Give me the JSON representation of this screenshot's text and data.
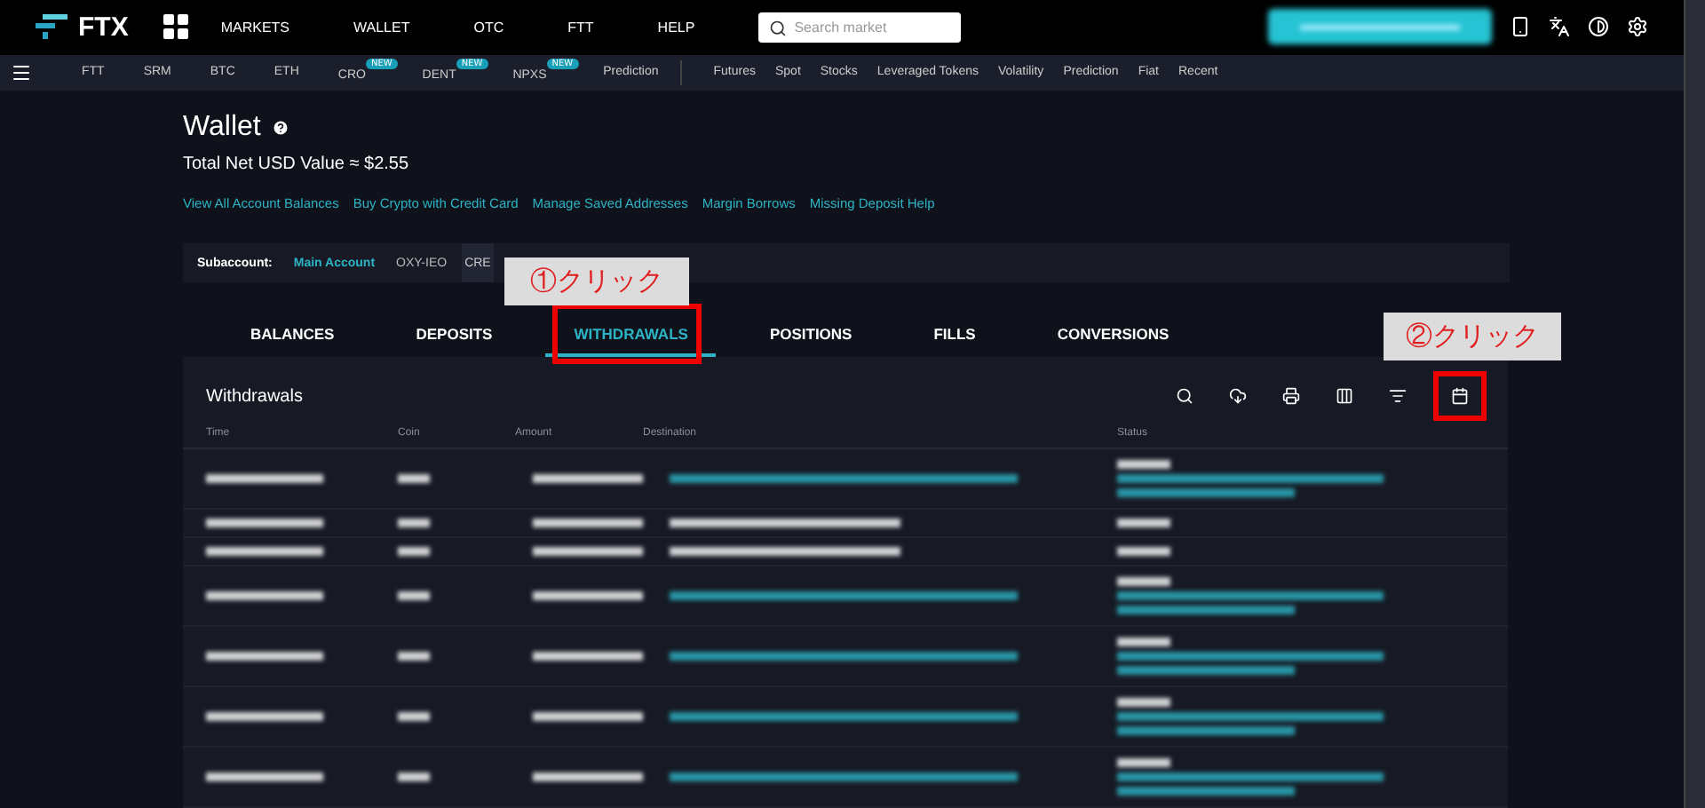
{
  "header": {
    "logo": "FTX",
    "nav": [
      "MARKETS",
      "WALLET",
      "OTC",
      "FTT",
      "HELP"
    ],
    "search": {
      "placeholder": "Search market"
    }
  },
  "subnav": {
    "left": [
      {
        "label": "FTT"
      },
      {
        "label": "SRM"
      },
      {
        "label": "BTC"
      },
      {
        "label": "ETH"
      },
      {
        "label": "CRO",
        "badge": "NEW"
      },
      {
        "label": "DENT",
        "badge": "NEW"
      },
      {
        "label": "NPXS",
        "badge": "NEW"
      },
      {
        "label": "Prediction"
      }
    ],
    "right": [
      {
        "label": "Futures"
      },
      {
        "label": "Spot"
      },
      {
        "label": "Stocks"
      },
      {
        "label": "Leveraged Tokens"
      },
      {
        "label": "Volatility"
      },
      {
        "label": "Prediction"
      },
      {
        "label": "Fiat"
      },
      {
        "label": "Recent"
      }
    ]
  },
  "page": {
    "title": "Wallet",
    "total": "Total Net USD Value ≈ $2.55",
    "links": [
      "View All Account Balances",
      "Buy Crypto with Credit Card",
      "Manage Saved Addresses",
      "Margin Borrows",
      "Missing Deposit Help"
    ]
  },
  "subaccount": {
    "label": "Subaccount:",
    "accounts": [
      {
        "label": "Main Account",
        "selected": true
      },
      {
        "label": "OXY-IEO",
        "selected": false
      }
    ],
    "button": "CRE"
  },
  "tabs": [
    {
      "label": "BALANCES",
      "selected": false,
      "highlighted": false
    },
    {
      "label": "DEPOSITS",
      "selected": false,
      "highlighted": false
    },
    {
      "label": "WITHDRAWALS",
      "selected": true,
      "highlighted": true
    },
    {
      "label": "POSITIONS",
      "selected": false,
      "highlighted": false
    },
    {
      "label": "FILLS",
      "selected": false,
      "highlighted": false
    },
    {
      "label": "CONVERSIONS",
      "selected": false,
      "highlighted": false
    }
  ],
  "panel": {
    "title": "Withdrawals",
    "toolbar": [
      {
        "kind": "search",
        "highlighted": false
      },
      {
        "kind": "download",
        "highlighted": false
      },
      {
        "kind": "print",
        "highlighted": false
      },
      {
        "kind": "columns",
        "highlighted": false
      },
      {
        "kind": "filter",
        "highlighted": false
      },
      {
        "kind": "calendar",
        "highlighted": true
      }
    ],
    "columns": [
      "Time",
      "Coin",
      "Amount",
      "Destination",
      "Status"
    ],
    "rows": [
      {
        "kind": "external"
      },
      {
        "kind": "transfer"
      },
      {
        "kind": "transfer"
      },
      {
        "kind": "external"
      },
      {
        "kind": "external"
      },
      {
        "kind": "external"
      },
      {
        "kind": "external"
      }
    ]
  },
  "annotations": [
    {
      "text": "①クリック"
    },
    {
      "text": "②クリック"
    }
  ]
}
